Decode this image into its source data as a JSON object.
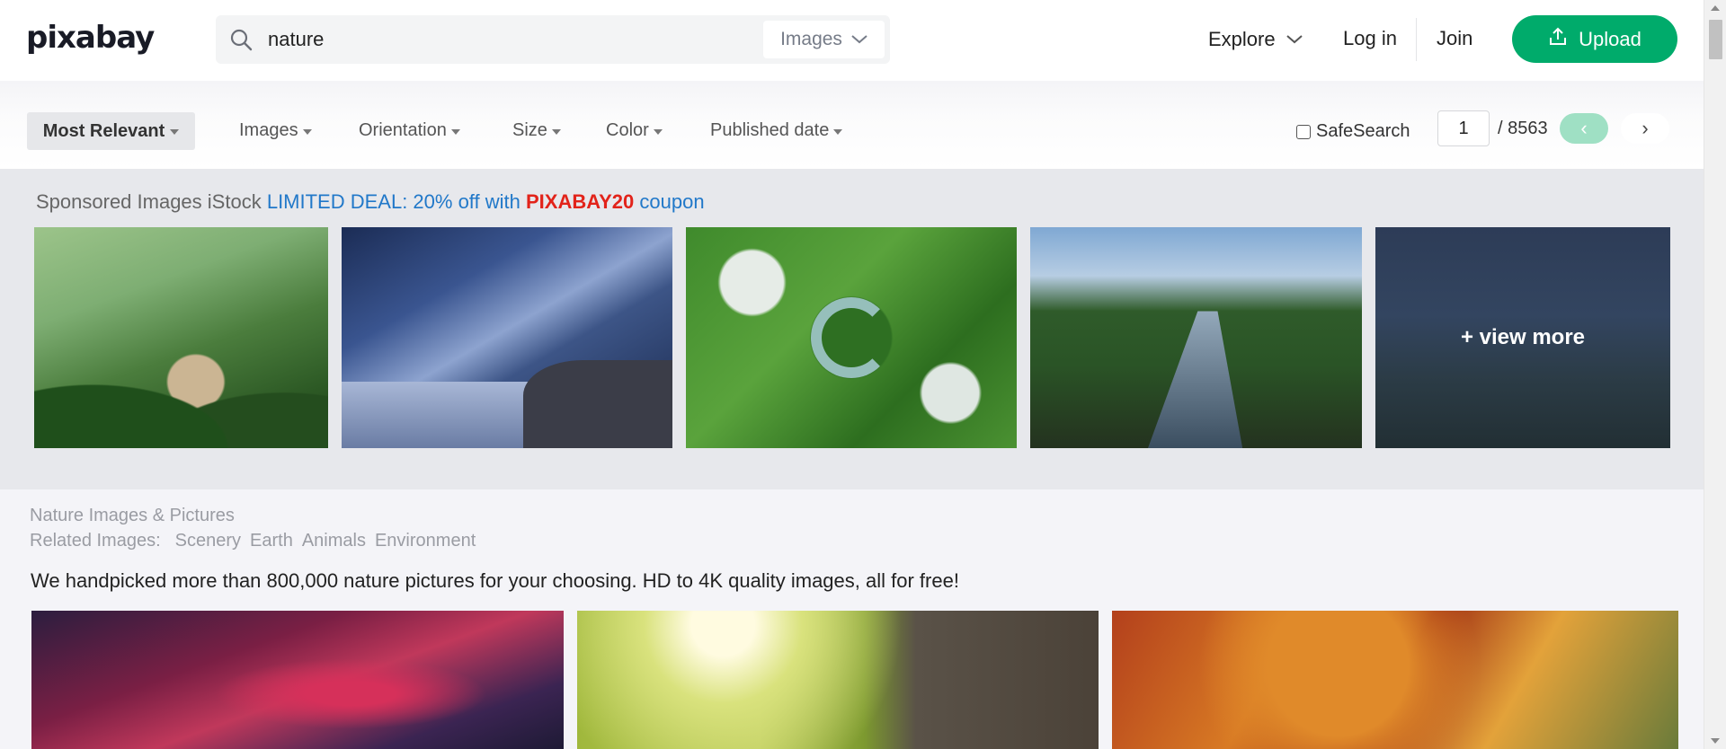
{
  "header": {
    "logo": "pixabay",
    "search": {
      "value": "nature",
      "type_label": "Images"
    },
    "nav": {
      "explore": "Explore",
      "login": "Log in",
      "join": "Join",
      "upload": "Upload"
    }
  },
  "filters": {
    "sort": "Most Relevant",
    "items": [
      "Images",
      "Orientation",
      "Size",
      "Color",
      "Published date"
    ],
    "safesearch": "SafeSearch",
    "pagination": {
      "current": "1",
      "total": "/ 8563",
      "prev": "‹",
      "next": "›"
    }
  },
  "sponsored": {
    "prefix": "Sponsored Images iStock",
    "deal": "LIMITED DEAL: 20% off with",
    "code": "PIXABAY20",
    "suffix": "coupon",
    "view_more": "+ view more"
  },
  "main": {
    "title": "Nature Images & Pictures",
    "related_label": "Related Images:",
    "related": [
      "Scenery",
      "Earth",
      "Animals",
      "Environment"
    ],
    "intro": "We handpicked more than 800,000 nature pictures for your choosing. HD to 4K quality images, all for free!"
  },
  "colors": {
    "brand": "#00ab6b",
    "link": "#2178c9",
    "coupon": "#e2231a"
  }
}
